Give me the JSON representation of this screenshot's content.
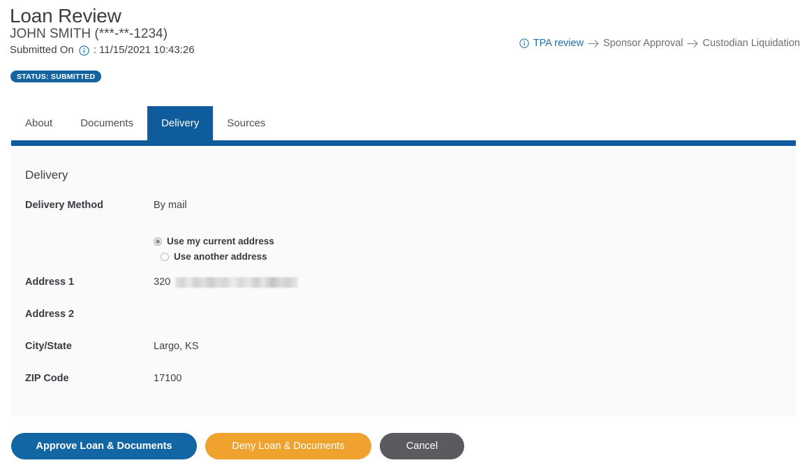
{
  "header": {
    "title": "Loan Review",
    "subject": "JOHN SMITH (***-**-1234)",
    "submitted_label": "Submitted On",
    "submitted_separator": ": 11/15/2021 10:43:26",
    "info_icon": "info-circle-icon",
    "status_badge": "STATUS: SUBMITTED",
    "status_color": "#1464a0"
  },
  "workflow": {
    "steps": [
      {
        "label": "TPA review",
        "active": true,
        "icon": "info-circle-icon"
      },
      {
        "label": "Sponsor Approval",
        "active": false,
        "icon": ""
      },
      {
        "label": "Custodian Liquidation",
        "active": false,
        "icon": ""
      }
    ],
    "arrow": "→",
    "active_color": "#1b6ca8",
    "inactive_color": "#6d6d72"
  },
  "tabs": {
    "items": [
      {
        "label": "About",
        "active": false
      },
      {
        "label": "Documents",
        "active": false
      },
      {
        "label": "Delivery",
        "active": true
      },
      {
        "label": "Sources",
        "active": false
      }
    ],
    "active_color": "#0f5c9c"
  },
  "panel": {
    "heading": "Delivery",
    "fields": [
      {
        "label": "Delivery Method",
        "value": "By mail"
      },
      {
        "label": "Address 1",
        "value": "320",
        "redacted": true
      },
      {
        "label": "Address 2",
        "value": ""
      },
      {
        "label": "City/State",
        "value": "Largo, KS"
      },
      {
        "label": "ZIP Code",
        "value": "17100"
      }
    ],
    "address_options": [
      {
        "label": "Use my current address",
        "selected": true
      },
      {
        "label": "Use another address",
        "selected": false
      }
    ]
  },
  "actions": {
    "approve": "Approve Loan & Documents",
    "deny": "Deny Loan & Documents",
    "cancel": "Cancel",
    "approve_color": "#1266a4",
    "deny_color": "#f0a22e",
    "cancel_color": "#5a5a5f"
  }
}
